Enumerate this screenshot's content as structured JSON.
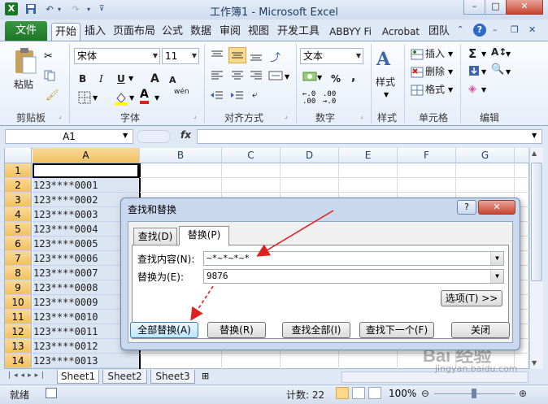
{
  "window": {
    "title": "工作簿1 - Microsoft Excel",
    "min": "–",
    "max": "□",
    "close": "✕"
  },
  "ribbon_tabs": [
    "文件",
    "开始",
    "插入",
    "页面布局",
    "公式",
    "数据",
    "审阅",
    "视图",
    "开发工具",
    "ABBYY Fi",
    "Acrobat",
    "团队"
  ],
  "clipboard": {
    "paste": "粘贴",
    "label": "剪贴板"
  },
  "font": {
    "name": "宋体",
    "size": "11",
    "label": "字体",
    "bold": "B",
    "italic": "I",
    "underline": "U",
    "grow": "A",
    "shrink": "A",
    "wen": "wén"
  },
  "alignment": {
    "label": "对齐方式"
  },
  "number": {
    "format": "文本",
    "label": "数字",
    "percent": "%",
    "comma": ","
  },
  "styles": {
    "label": "样式"
  },
  "cells": {
    "insert": "插入",
    "delete": "删除",
    "format": "格式",
    "label": "单元格"
  },
  "editing": {
    "sum": "Σ",
    "label": "编辑"
  },
  "formula_bar": {
    "name_box": "A1",
    "fx": "fx",
    "value": ""
  },
  "columns": [
    "A",
    "B",
    "C",
    "D",
    "E",
    "F",
    "G"
  ],
  "rows": [
    "1",
    "2",
    "3",
    "4",
    "5",
    "6",
    "7",
    "8",
    "9",
    "10",
    "11",
    "12",
    "13",
    "14"
  ],
  "cellsA": [
    "",
    "123****0001",
    "123****0002",
    "123****0003",
    "123****0004",
    "123****0005",
    "123****0006",
    "123****0007",
    "123****0008",
    "123****0009",
    "123****0010",
    "123****0011",
    "123****0012",
    "123****0013"
  ],
  "sheets": [
    "Sheet1",
    "Sheet2",
    "Sheet3"
  ],
  "status": {
    "ready": "就绪",
    "count": "计数: 22",
    "zoom": "100%"
  },
  "dialog": {
    "title": "查找和替换",
    "help": "?",
    "close": "✕",
    "tab_find": "查找(D)",
    "tab_replace": "替换(P)",
    "find_label": "查找内容(N):",
    "find_value": "~*~*~*~*",
    "replace_label": "替换为(E):",
    "replace_value": "9876",
    "options": "选项(T) >>",
    "replace_all": "全部替换(A)",
    "replace": "替换(R)",
    "find_all": "查找全部(I)",
    "find_next": "查找下一个(F)",
    "close_btn": "关闭"
  },
  "watermark": {
    "brand": "Bai 经验",
    "url": "jingyan.baidu.com"
  },
  "colors": {
    "file_tab": "#1d7628",
    "selection": "#dbe5f1",
    "arrow": "#e02020"
  }
}
